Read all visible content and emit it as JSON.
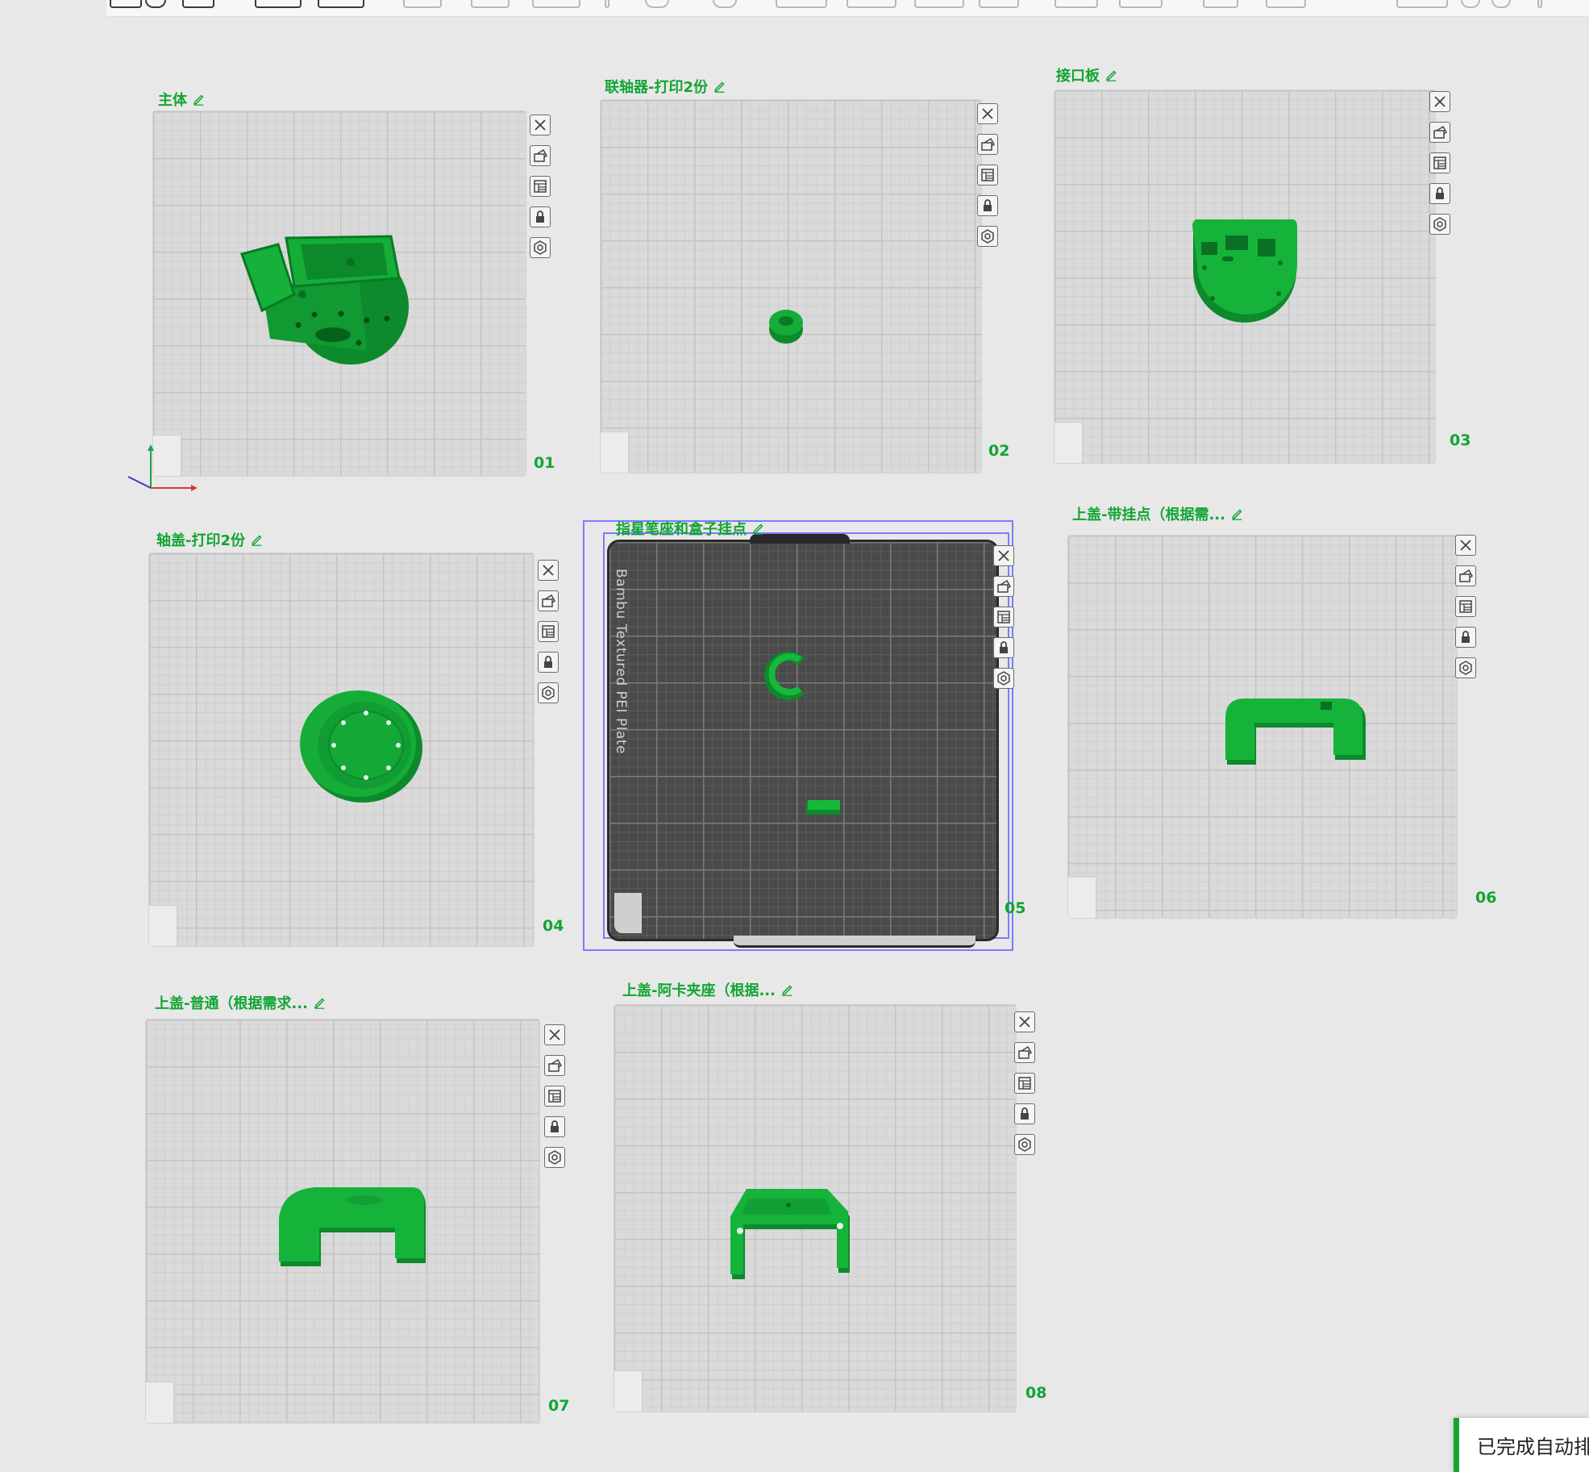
{
  "plates": [
    {
      "title": "主体",
      "number": "01"
    },
    {
      "title": "联轴器-打印2份",
      "number": "02"
    },
    {
      "title": "接口板",
      "number": "03"
    },
    {
      "title": "轴盖-打印2份",
      "number": "04"
    },
    {
      "title": "指星笔座和盒子挂点",
      "number": "05",
      "bed_label": "Bambu Textured PEI Plate"
    },
    {
      "title": "上盖-带挂点（根据需...",
      "number": "06"
    },
    {
      "title": "上盖-普通（根据需求...",
      "number": "07"
    },
    {
      "title": "上盖-阿卡夹座（根据...",
      "number": "08"
    }
  ],
  "plate_buttons": [
    "close-icon",
    "arrange-icon",
    "layout-icon",
    "lock-icon",
    "settings-icon"
  ],
  "toast": {
    "message": "已完成自动排"
  },
  "colors": {
    "accent": "#11a533",
    "model": "#0f9c33",
    "selection": "#7b7bff"
  }
}
